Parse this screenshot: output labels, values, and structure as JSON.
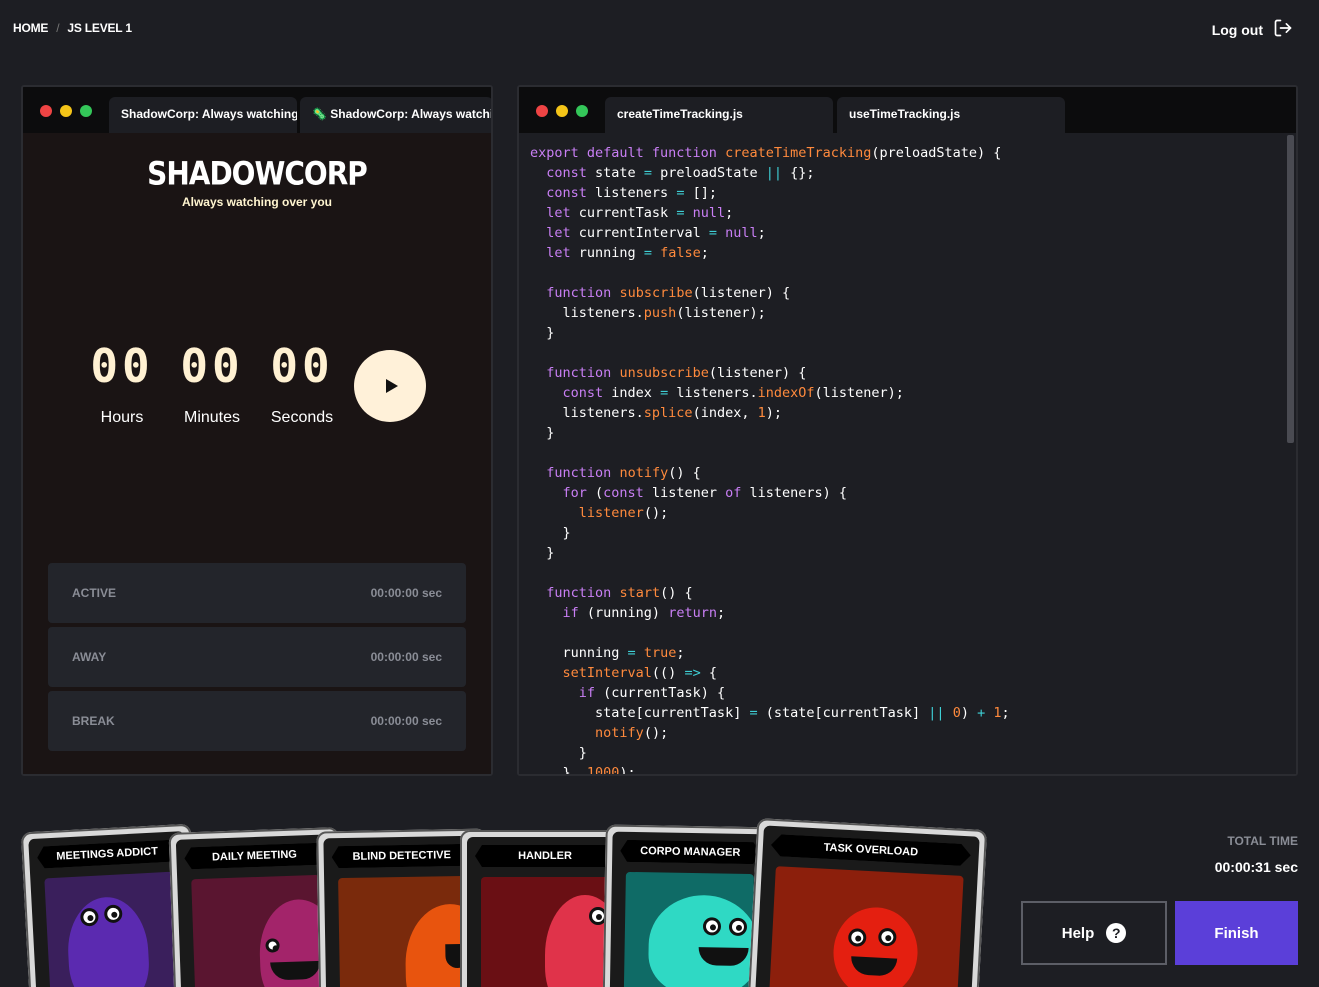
{
  "breadcrumb": {
    "home": "HOME",
    "sep": "/",
    "current": "JS LEVEL 1"
  },
  "header": {
    "logout_label": "Log out"
  },
  "left_window": {
    "tabs": [
      {
        "label": "ShadowCorp: Always watching"
      },
      {
        "icon": "🦠",
        "label": "ShadowCorp: Always watching"
      }
    ],
    "app": {
      "logo": "SHADOWCORP",
      "tagline": "Always watching over you",
      "timer": {
        "hours": "00",
        "hours_label": "Hours",
        "minutes": "00",
        "minutes_label": "Minutes",
        "seconds": "00",
        "seconds_label": "Seconds"
      },
      "statuses": [
        {
          "label": "ACTIVE",
          "value": "00:00:00 sec"
        },
        {
          "label": "AWAY",
          "value": "00:00:00 sec"
        },
        {
          "label": "BREAK",
          "value": "00:00:00 sec"
        }
      ]
    }
  },
  "editor": {
    "tabs": [
      {
        "label": "createTimeTracking.js",
        "active": true
      },
      {
        "label": "useTimeTracking.js",
        "active": false
      }
    ]
  },
  "cards": [
    {
      "title": "MEETINGS ADDICT",
      "art_color": "#3a1f5c",
      "monster_color": "#5b2ab0"
    },
    {
      "title": "DAILY MEETING",
      "art_color": "#5a1530",
      "monster_color": "#a3246a"
    },
    {
      "title": "BLIND DETECTIVE",
      "art_color": "#7a2a0c",
      "monster_color": "#e8540e"
    },
    {
      "title": "HANDLER",
      "art_color": "#6a0f14",
      "monster_color": "#e0334a"
    },
    {
      "title": "CORPO MANAGER",
      "art_color": "#0f6b66",
      "monster_color": "#2fd9c4"
    },
    {
      "title": "TASK OVERLOAD",
      "art_color": "#8c1f0c",
      "monster_color": "#e41f10"
    }
  ],
  "footer": {
    "total_label": "TOTAL TIME",
    "total_value": "00:00:31 sec",
    "help_label": "Help",
    "finish_label": "Finish"
  },
  "colors": {
    "accent": "#5b3fd9",
    "timer_digit": "#fff1d2",
    "code_keyword": "#c97ff5",
    "code_function": "#ff8a3d",
    "code_operator": "#3fd0d6"
  }
}
